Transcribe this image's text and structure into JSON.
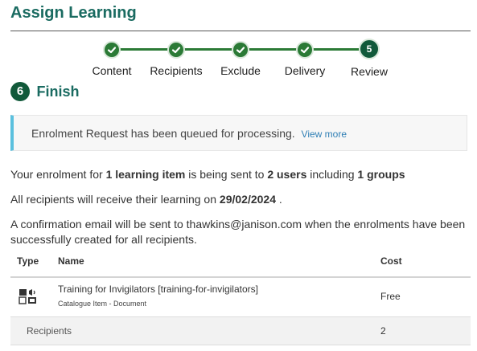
{
  "header": {
    "title": "Assign Learning"
  },
  "stepper": {
    "steps": [
      {
        "label": "Content",
        "state": "complete"
      },
      {
        "label": "Recipients",
        "state": "complete"
      },
      {
        "label": "Exclude",
        "state": "complete"
      },
      {
        "label": "Delivery",
        "state": "complete"
      },
      {
        "label": "Review",
        "state": "current",
        "number": "5"
      }
    ]
  },
  "finish": {
    "number": "6",
    "label": "Finish"
  },
  "alert": {
    "message": "Enrolment Request has been queued for processing.",
    "link": "View more"
  },
  "summary_lines": {
    "line1": {
      "p1": "Your enrolment for ",
      "b1": "1 learning item",
      "p2": " is being sent to ",
      "b2": "2 users",
      "p3": " including ",
      "b3": "1 groups"
    },
    "line2": {
      "p1": "All recipients will receive their learning on ",
      "b1": "29/02/2024",
      "p2": " ."
    },
    "line3": {
      "text1": "A confirmation email will be sent to thawkins@janison.com when the enrolments have been",
      "text2": "successfully created for all recipients."
    }
  },
  "table": {
    "headers": {
      "type": "Type",
      "name": "Name",
      "cost": "Cost"
    },
    "rows": [
      {
        "type_icon": "document-media-icon",
        "name": "Training for Invigilators [training-for-invigilators]",
        "subtitle": "Catalogue Item - Document",
        "cost": "Free"
      }
    ],
    "summary": {
      "label": "Recipients",
      "value": "2"
    }
  },
  "colors": {
    "title": "#1a6b61",
    "step_complete": "#2b7a36",
    "step_current": "#11593a",
    "alert_accent": "#5bc0de",
    "link": "#2f7fb5"
  }
}
